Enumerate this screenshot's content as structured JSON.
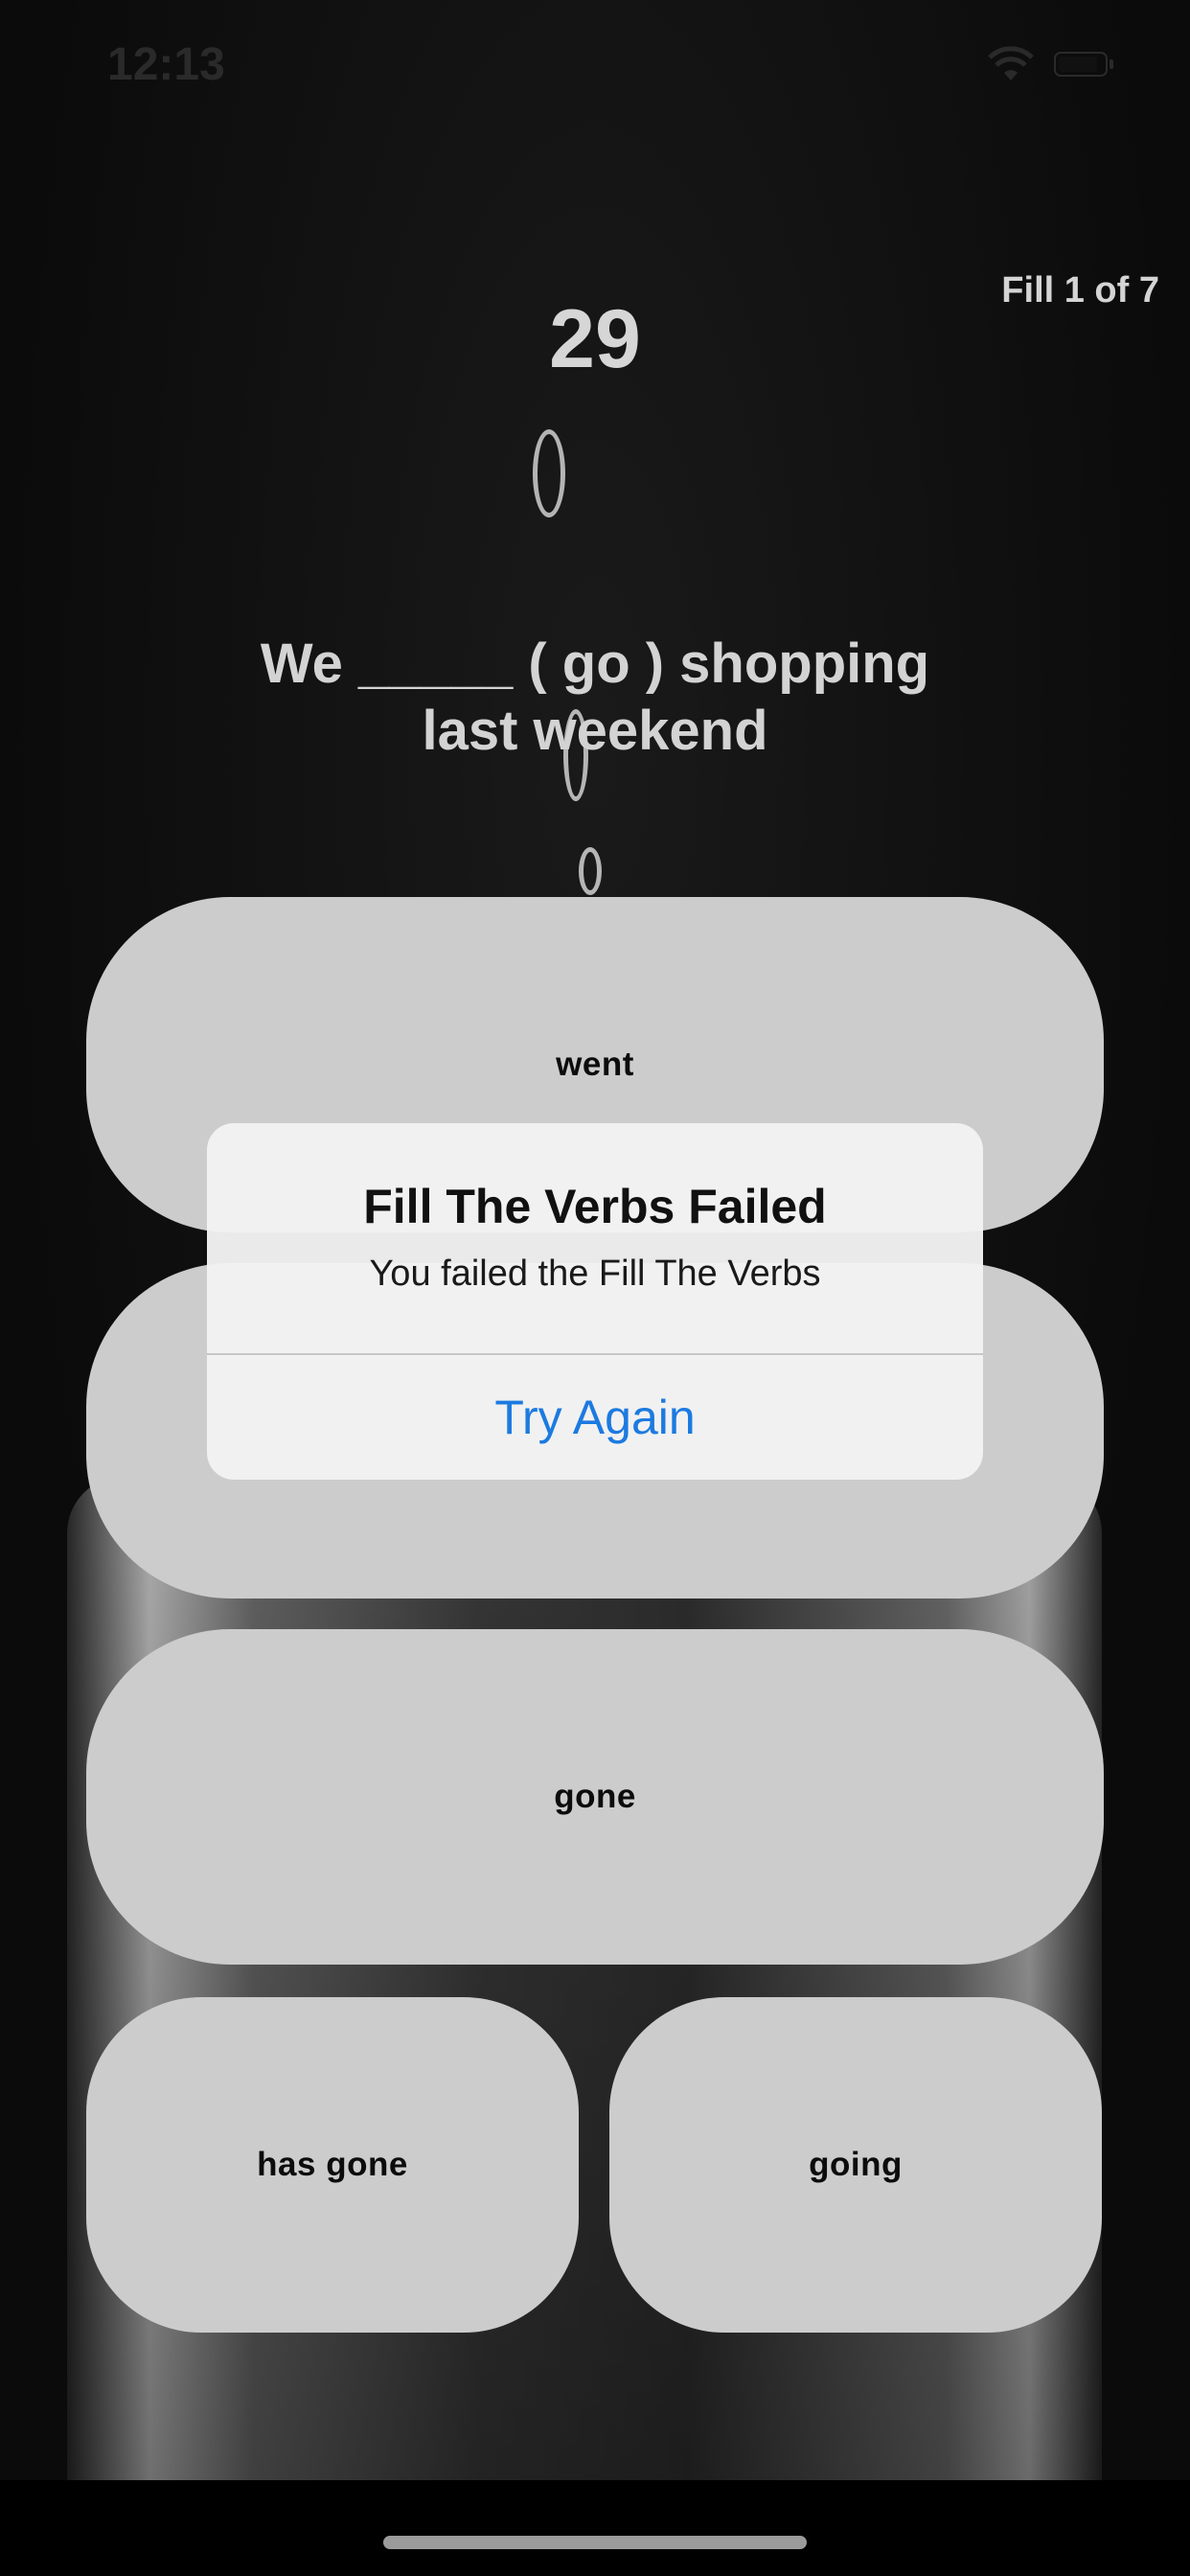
{
  "status_bar": {
    "time": "12:13"
  },
  "game": {
    "counter": "Fill 1 of 7",
    "timer": "29",
    "question": "We _____ ( go ) shopping last weekend"
  },
  "options": [
    "went",
    "",
    "gone",
    "has gone",
    "going"
  ],
  "alert": {
    "title": "Fill The Verbs Failed",
    "message": "You failed the Fill The Verbs",
    "action": "Try Again"
  },
  "colors": {
    "accent": "#1c7ae0",
    "option_bg": "#cccccc",
    "background": "#0d0d0d"
  }
}
